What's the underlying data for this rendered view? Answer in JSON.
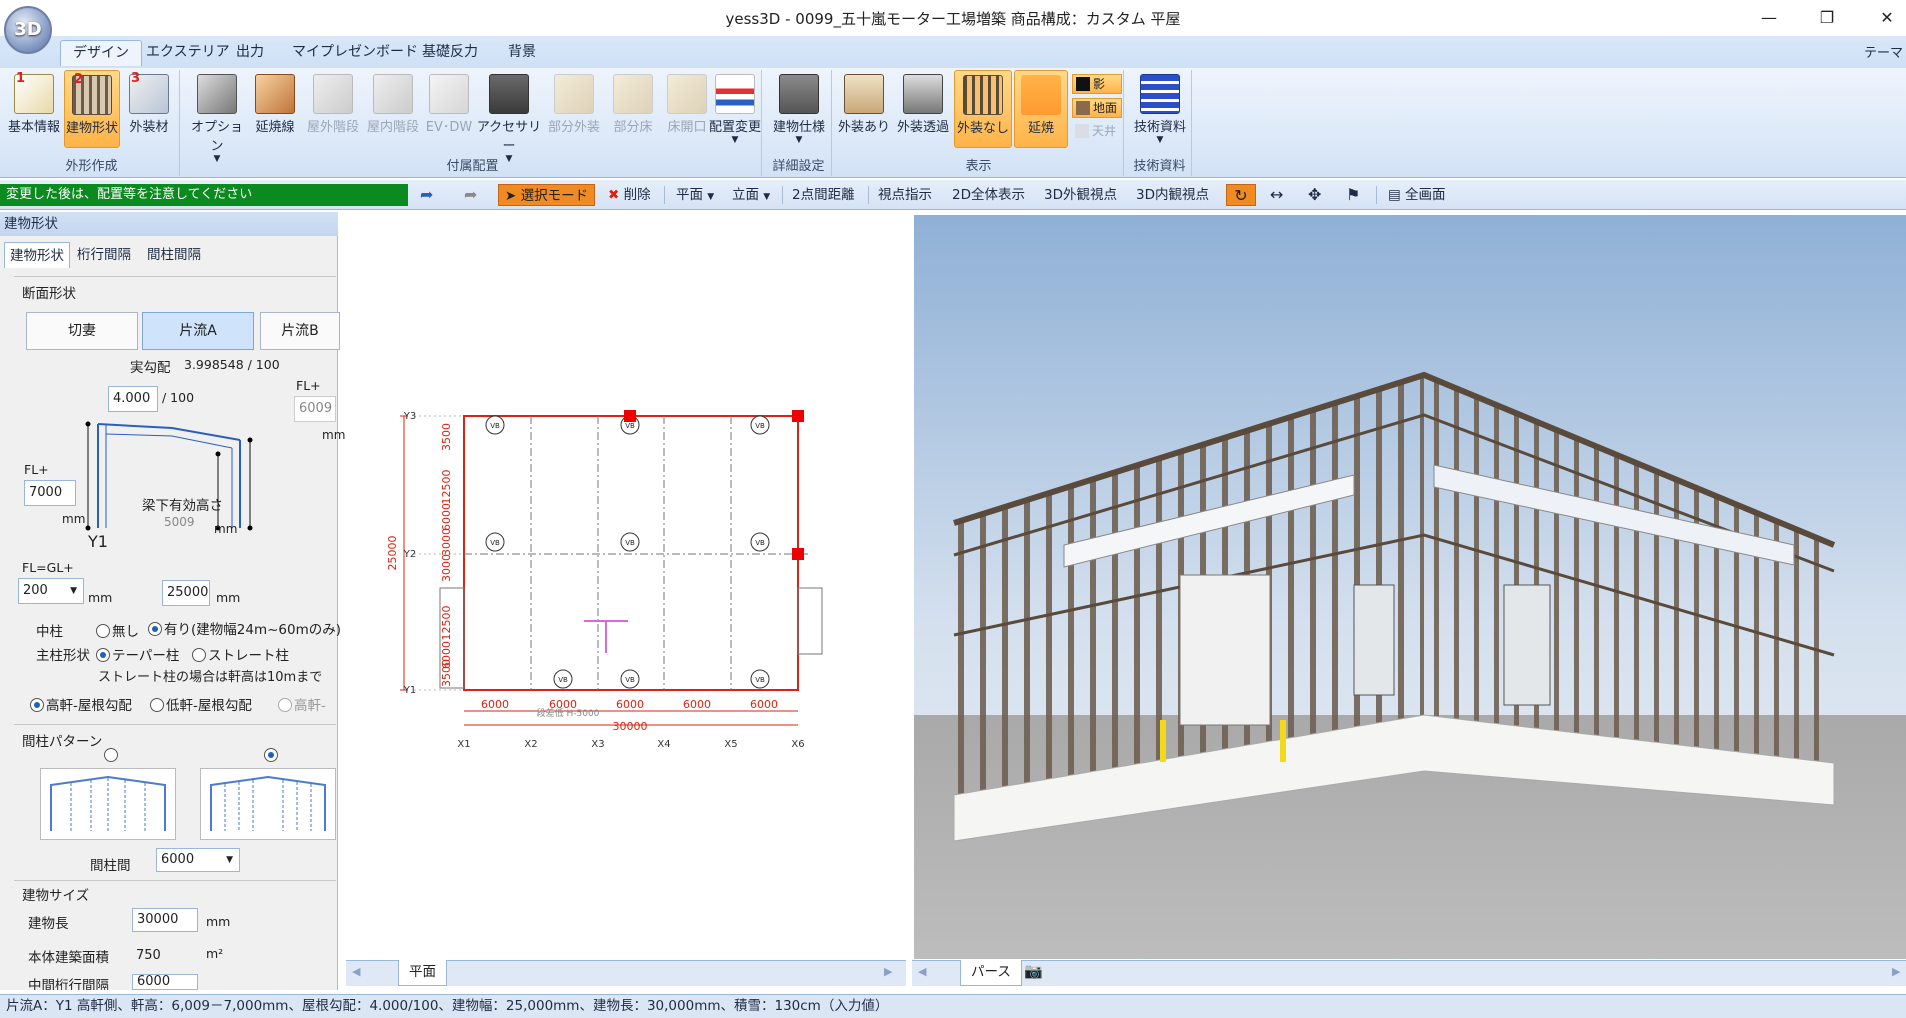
{
  "window": {
    "title": "yess3D - 0099_五十嵐モーター工場増築 商品構成：カスタム 平屋",
    "orb": "3D"
  },
  "ribbon_tabs": [
    "デザイン",
    "エクステリア",
    "出力",
    "マイプレゼンボード",
    "基礎反力",
    "背景"
  ],
  "theme_label": "テーマ",
  "ribbon": {
    "group_outline": {
      "label": "外形作成",
      "buttons": [
        "基本情報",
        "建物形状",
        "外装材"
      ],
      "badges": [
        "1",
        "2",
        "3"
      ]
    },
    "group_accessory": {
      "label": "付属配置",
      "buttons": [
        "オプション",
        "延焼線",
        "屋外階段",
        "屋内階段",
        "EV･DW",
        "アクセサリー",
        "部分外装",
        "部分床",
        "床開口",
        "配置変更"
      ]
    },
    "group_detail": {
      "label": "詳細設定",
      "buttons": [
        "建物仕様"
      ]
    },
    "group_display": {
      "label": "表示",
      "buttons": [
        "外装あり",
        "外装透過",
        "外装なし",
        "延焼"
      ],
      "small": [
        "影",
        "地面",
        "天井"
      ]
    },
    "group_docs": {
      "label": "技術資料",
      "buttons": [
        "技術資料"
      ]
    }
  },
  "status_message": "変更した後は、配置等を注意してください",
  "toolbar": {
    "select_mode": "選択モード",
    "delete": "削除",
    "plan": "平面",
    "elevation": "立面",
    "distance": "2点間距離",
    "viewpoint": "視点指示",
    "full2d": "2D全体表示",
    "ext3d": "3D外観視点",
    "int3d": "3D内観視点",
    "fullscreen": "全画面"
  },
  "left_panel": {
    "header": "建物形状",
    "tabs": [
      "建物形状",
      "桁行間隔",
      "間柱間隔"
    ],
    "section_shape": "断面形状",
    "shape_options": [
      "切妻",
      "片流A",
      "片流B"
    ],
    "actual_slope_label": "実勾配",
    "actual_slope_value": "3.998548 / 100",
    "slope_input": "4.000",
    "slope_unit": "/ 100",
    "fl_plus_right": "FL+",
    "fl_plus_right_value": "6009",
    "fl_plus_left": "FL+",
    "eave_height": "7000",
    "beam_clear_label": "梁下有効高さ",
    "beam_clear_value": "5009",
    "mm": "mm",
    "y1": "Y1",
    "fl_gl": "FL=GL+",
    "fl_gl_value": "200",
    "width_value": "25000",
    "center_column_label": "中柱",
    "center_column_none": "無し",
    "center_column_yes": "有り(建物幅24m~60mのみ)",
    "main_column_label": "主柱形状",
    "main_column_taper": "テーパー柱",
    "main_column_straight": "ストレート柱",
    "straight_note": "ストレート柱の場合は軒高は10mまで",
    "eave_high": "高軒-屋根勾配",
    "eave_low": "低軒-屋根勾配",
    "eave_high2": "高軒-",
    "stud_pattern_label": "間柱パターン",
    "stud_pitch_label": "間柱間",
    "stud_pitch_value": "6000",
    "size_label": "建物サイズ",
    "length_label": "建物長",
    "length_value": "30000",
    "area_label": "本体建築面積",
    "area_value": "750",
    "area_unit": "m²",
    "mid_bay_label": "中間桁行間隔",
    "mid_bay_value": "6000"
  },
  "plan": {
    "tab": "平面",
    "y_labels": [
      "Y3",
      "Y2",
      "Y1"
    ],
    "x_labels": [
      "X1",
      "X2",
      "X3",
      "X4",
      "X5",
      "X6"
    ],
    "bays": [
      "6000",
      "6000",
      "6000",
      "6000",
      "6000"
    ],
    "total_x": "30000",
    "total_y": "25000",
    "dims_left": [
      "3500",
      "12500",
      "6000",
      "3000",
      "3000",
      "12500",
      "6000",
      "3500"
    ],
    "vb": "VB",
    "step_note": "段差低 H-5000"
  },
  "view3d": {
    "tab": "パース"
  },
  "statusbar": "片流A：Y1 高軒側、軒高：6,009－7,000mm、屋根勾配：4.000/100、建物幅：25,000mm、建物長：30,000mm、積雪：130cm（入力値）"
}
